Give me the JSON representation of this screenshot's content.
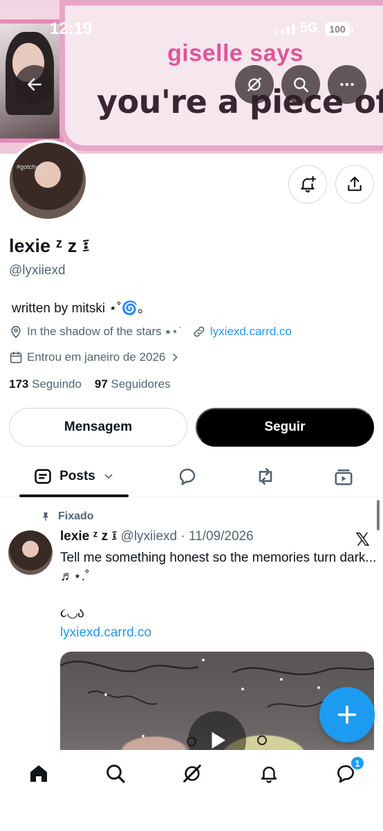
{
  "status_bar": {
    "time": "12:19",
    "network": "5G",
    "battery": "100"
  },
  "banner": {
    "headline": "giselle says",
    "subline": "you're a piece of sh"
  },
  "profile": {
    "avatar_tag": "#gotchyu",
    "display_name": "lexie ᶻ z ፤",
    "handle": "@lyxiiexd",
    "bio": "written by mitski ⋆˚🌀｡",
    "location": "In the shadow of the stars ⭑⋆˙",
    "website": "lyxiexd.carrd.co",
    "joined": "Entrou em janeiro de 2026",
    "following_count": "173",
    "following_label": "Seguindo",
    "followers_count": "97",
    "followers_label": "Seguidores"
  },
  "actions": {
    "message_label": "Mensagem",
    "follow_label": "Seguir"
  },
  "tabs": {
    "posts_label": "Posts"
  },
  "pinned_post": {
    "pinned_label": "Fixado",
    "author_name": "lexie ᶻ z ፤",
    "author_meta": "@lyxiiexd · 11/09/2026",
    "text": "Tell me something honest so the memories turn dark... ♬⋆.˚",
    "decoration": "૮◟◞ა",
    "link": "lyxiexd.carrd.co"
  },
  "bottom_nav": {
    "messages_badge": "1"
  },
  "colors": {
    "accent": "#1d9bf0",
    "text": "#0f1419",
    "muted": "#536471",
    "banner_pink": "#e0559a"
  }
}
